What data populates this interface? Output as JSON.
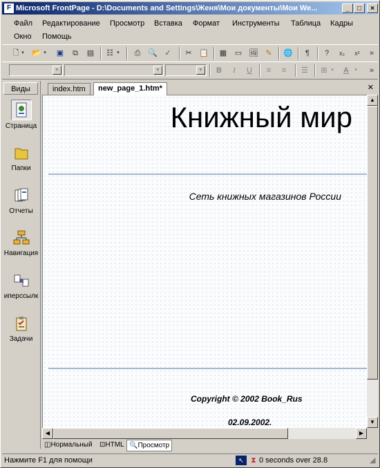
{
  "titlebar": {
    "title": "Microsoft FrontPage - D:\\Documents and Settings\\Женя\\Мои документы\\Мои We..."
  },
  "menu": [
    "Файл",
    "Редактирование",
    "Просмотр",
    "Вставка",
    "Формат",
    "Инструменты",
    "Таблица",
    "Кадры",
    "Окно",
    "Помощь"
  ],
  "views": {
    "title": "Виды",
    "items": [
      {
        "label": "Страница"
      },
      {
        "label": "Папки"
      },
      {
        "label": "Отчеты"
      },
      {
        "label": "Навигация"
      },
      {
        "label": "иперссылк"
      },
      {
        "label": "Задачи"
      }
    ]
  },
  "tabs": {
    "index": "index.htm",
    "active": "new_page_1.htm*"
  },
  "page": {
    "heading": "Книжный мир",
    "subtitle": "Сеть книжных магазинов России",
    "copyright": "Copyright © 2002 Book_Rus",
    "date": "02.09.2002."
  },
  "modes": {
    "normal": "Нормальный",
    "html": "HTML",
    "preview": "Просмотр"
  },
  "status": {
    "hint": "Нажмите F1 для помощи",
    "speed": "0 seconds over 28.8"
  }
}
